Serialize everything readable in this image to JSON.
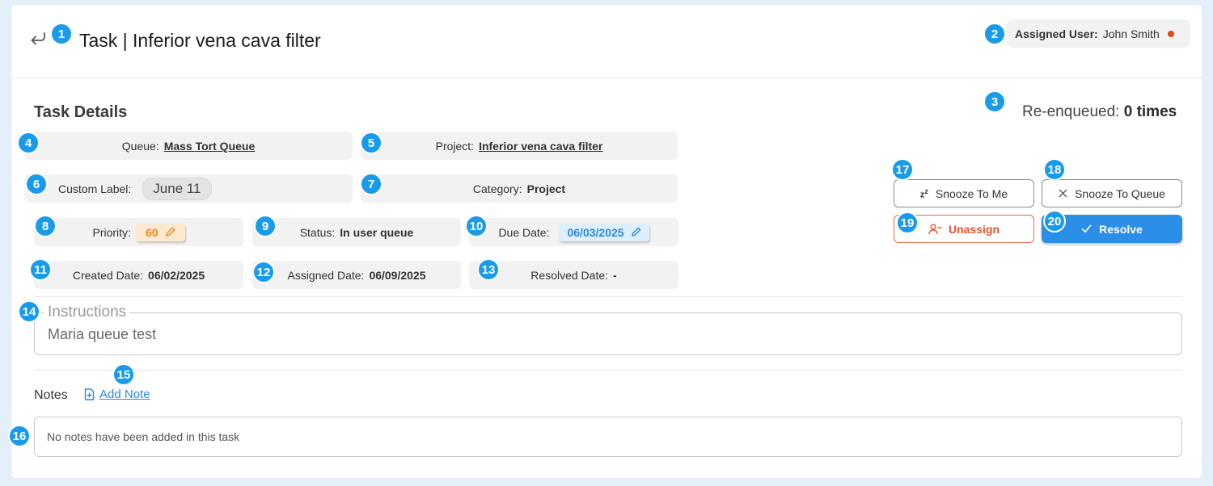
{
  "header": {
    "title": "Task | Inferior vena cava filter",
    "assigned_user_label": "Assigned User:",
    "assigned_user_value": "John Smith",
    "assigned_user_status_color": "#e5481c"
  },
  "details": {
    "section_title": "Task Details",
    "reenqueued_label": "Re-enqueued:",
    "reenqueued_value": "0 times",
    "queue_label": "Queue:",
    "queue_value": "Mass Tort Queue",
    "project_label": "Project:",
    "project_value": "Inferior vena cava filter",
    "custom_label_label": "Custom Label:",
    "custom_label_value": "June 11",
    "category_label": "Category:",
    "category_value": "Project",
    "priority_label": "Priority:",
    "priority_value": "60",
    "status_label": "Status:",
    "status_value": "In user queue",
    "due_date_label": "Due Date:",
    "due_date_value": "06/03/2025",
    "created_date_label": "Created Date:",
    "created_date_value": "06/02/2025",
    "assigned_date_label": "Assigned Date:",
    "assigned_date_value": "06/09/2025",
    "resolved_date_label": "Resolved Date:",
    "resolved_date_value": "-"
  },
  "actions": {
    "snooze_to_me": "Snooze To Me",
    "snooze_to_queue": "Snooze To Queue",
    "unassign": "Unassign",
    "resolve": "Resolve"
  },
  "instructions": {
    "legend": "Instructions",
    "value": "Maria queue test"
  },
  "notes": {
    "label": "Notes",
    "add_note": "Add Note",
    "empty_text": "No notes have been added in this task"
  },
  "colors": {
    "accent": "#2b8fe8",
    "badge": "#1a9bea",
    "danger": "#e55334",
    "priority": "#e88a1c"
  },
  "badges": [
    "1",
    "2",
    "3",
    "4",
    "5",
    "6",
    "7",
    "8",
    "9",
    "10",
    "11",
    "12",
    "13",
    "14",
    "15",
    "16",
    "17",
    "18",
    "19",
    "20"
  ]
}
